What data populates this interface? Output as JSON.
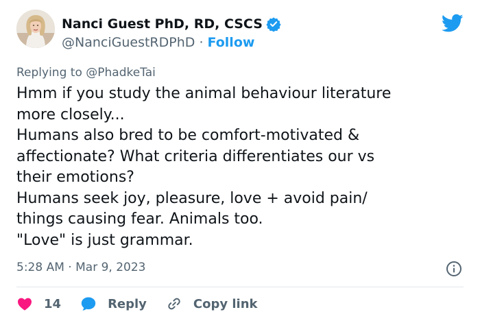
{
  "author": {
    "name": "Nanci Guest PhD, RD, CSCS",
    "handle": "@NanciGuestRDPhD",
    "separator": "·",
    "follow_label": "Follow",
    "verified": true
  },
  "reply": {
    "prefix": "Replying to ",
    "to_handle": "@PhadkeTai"
  },
  "tweet": {
    "lines": [
      "Hmm if you study the animal behaviour literature",
      "more closely...",
      "Humans also bred to be comfort-motivated &",
      "affectionate? What criteria differentiates our vs",
      "their emotions?",
      "Humans seek joy, pleasure, love + avoid pain/",
      "things causing fear.  Animals too.",
      "\"Love\" is just grammar."
    ],
    "time": "5:28 AM",
    "separator": "·",
    "date": "Mar 9, 2023"
  },
  "actions": {
    "likes": "14",
    "reply_label": "Reply",
    "copy_label": "Copy link"
  },
  "colors": {
    "accent": "#1d9bf0",
    "like": "#f91880",
    "muted": "#536471",
    "text": "#0f1419"
  },
  "icons": {
    "verified": "verified-badge-icon",
    "brand": "twitter-bird-icon",
    "info": "info-icon",
    "like": "heart-icon",
    "reply": "reply-bubble-icon",
    "copy": "link-icon"
  }
}
